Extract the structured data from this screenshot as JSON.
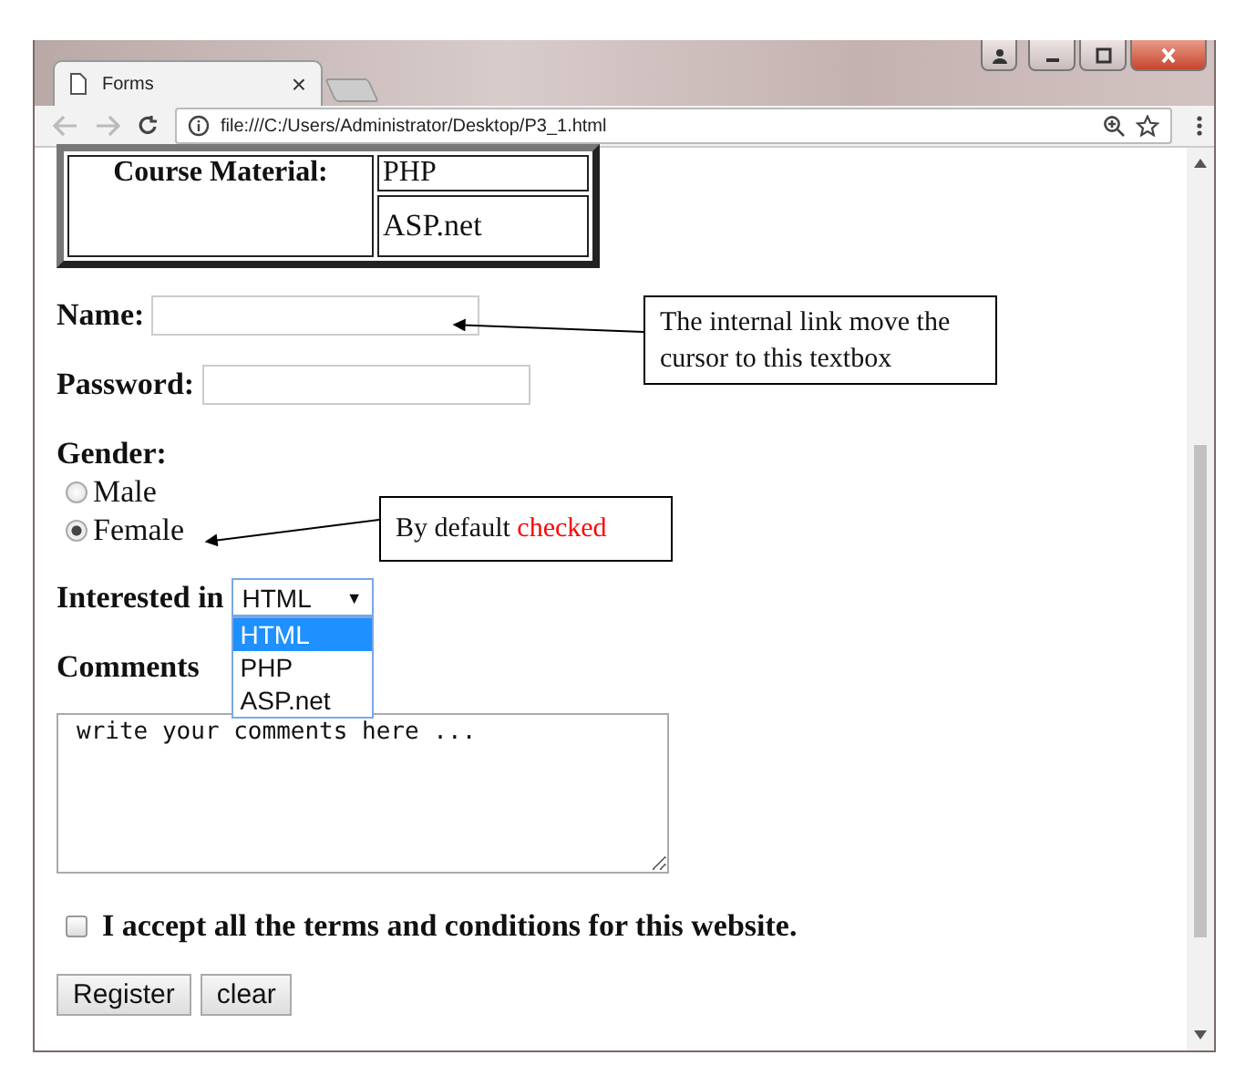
{
  "window": {
    "tab_title": "Forms",
    "tab_close": "×",
    "address": "file:///C:/Users/Administrator/Desktop/P3_1.html"
  },
  "table": {
    "label": "Course Material:",
    "cells": [
      "PHP",
      "ASP.net"
    ]
  },
  "form": {
    "name_label": "Name:",
    "password_label": "Password:",
    "gender_label": "Gender:",
    "gender_options": [
      {
        "label": "Male",
        "selected": false
      },
      {
        "label": "Female",
        "selected": true
      }
    ],
    "interest_label": "Interested in",
    "select": {
      "value": "HTML",
      "caret": "▼",
      "expanded": true,
      "options": [
        {
          "label": "HTML",
          "selected": true
        },
        {
          "label": "PHP",
          "selected": false
        },
        {
          "label": "ASP.net",
          "selected": false
        }
      ]
    },
    "comments_label": "Comments",
    "comments_value": "write your comments here ...",
    "terms": {
      "label": "I accept all the terms and conditions for this website.",
      "checked": false
    },
    "buttons": [
      "Register",
      "clear"
    ]
  },
  "callouts": [
    {
      "text": "The internal link move the cursor to this textbox"
    },
    {
      "text": "By default",
      "highlight": "checked"
    }
  ]
}
